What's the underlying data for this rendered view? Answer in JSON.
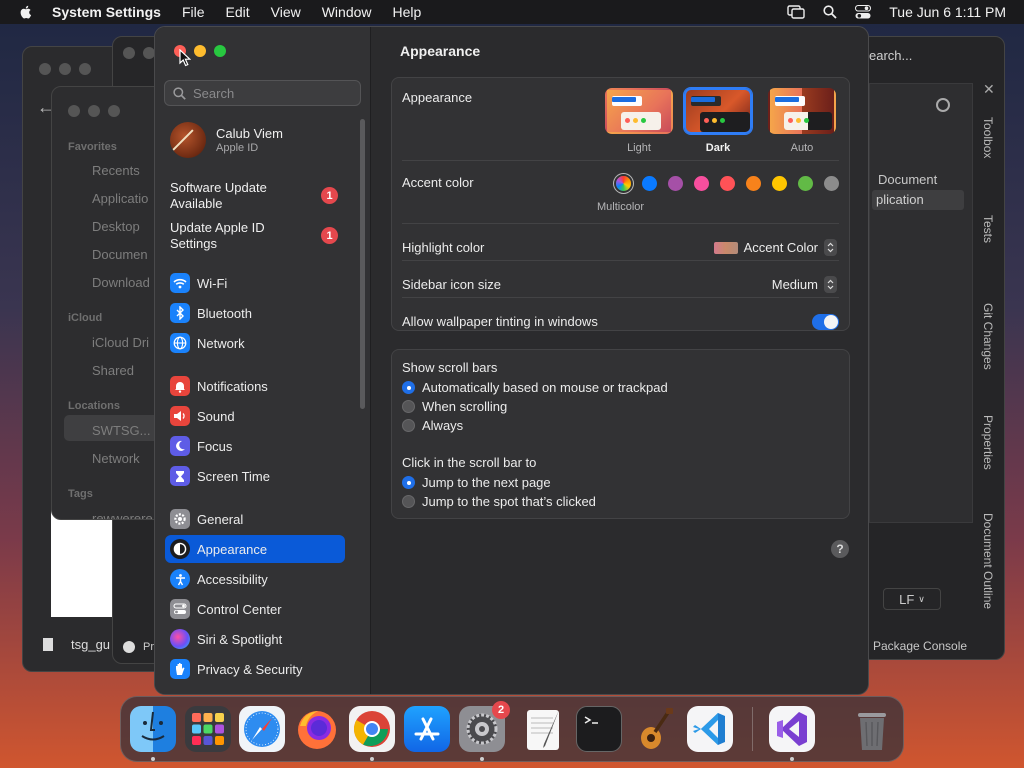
{
  "menubar": {
    "app_name": "System Settings",
    "menus": [
      "File",
      "Edit",
      "View",
      "Window",
      "Help"
    ],
    "clock": "Tue Jun 6  1:11 PM"
  },
  "finder": {
    "sections": [
      "Favorites",
      "iCloud",
      "Locations",
      "Tags"
    ],
    "favorites": [
      "Recents",
      "Applicatio",
      "Desktop",
      "Documen",
      "Download"
    ],
    "icloud": [
      "iCloud Dri",
      "Shared"
    ],
    "locations": [
      "SWTSG...",
      "Network"
    ],
    "tags": [
      "rewwerere"
    ],
    "file_name": "tsg_gu",
    "file_status": "Pr"
  },
  "ide": {
    "search_text": "earch...",
    "items": [
      "Document",
      "plication"
    ],
    "side_tabs": [
      "Toolbox",
      "Tests",
      "Git Changes",
      "Properties",
      "Document Outline"
    ],
    "line_ending": "LF",
    "console": "Package Console"
  },
  "settings": {
    "search_placeholder": "Search",
    "profile": {
      "name": "Calub Viem",
      "subtitle": "Apple ID"
    },
    "notices": [
      {
        "label": "Software Update Available",
        "badge": "1"
      },
      {
        "label": "Update Apple ID Settings",
        "badge": "1"
      }
    ],
    "sidebar": [
      {
        "label": "Wi-Fi",
        "icon": "wifi-icon",
        "color": "#1a82fb"
      },
      {
        "label": "Bluetooth",
        "icon": "bluetooth-icon",
        "color": "#1a82fb"
      },
      {
        "label": "Network",
        "icon": "globe-icon",
        "color": "#1a82fb"
      },
      {
        "label": "Notifications",
        "icon": "bell-icon",
        "color": "#e8453c"
      },
      {
        "label": "Sound",
        "icon": "speaker-icon",
        "color": "#e8453c"
      },
      {
        "label": "Focus",
        "icon": "moon-icon",
        "color": "#5e5ce6"
      },
      {
        "label": "Screen Time",
        "icon": "hourglass-icon",
        "color": "#5e5ce6"
      },
      {
        "label": "General",
        "icon": "gear-icon",
        "color": "#8e8e93"
      },
      {
        "label": "Appearance",
        "icon": "appearance-icon",
        "color": "#1c1c1e"
      },
      {
        "label": "Accessibility",
        "icon": "accessibility-icon",
        "color": "#1a82fb"
      },
      {
        "label": "Control Center",
        "icon": "control-center-icon",
        "color": "#8e8e93"
      },
      {
        "label": "Siri & Spotlight",
        "icon": "siri-icon",
        "color": "#9d4edd"
      },
      {
        "label": "Privacy & Security",
        "icon": "hand-icon",
        "color": "#1a82fb"
      }
    ],
    "active_item": "Appearance",
    "title": "Appearance",
    "appearance": {
      "label": "Appearance",
      "options": [
        "Light",
        "Dark",
        "Auto"
      ],
      "selected": "Dark"
    },
    "accent": {
      "label": "Accent color",
      "caption": "Multicolor",
      "colors": [
        "multicolor",
        "#0a7aff",
        "#a550a7",
        "#f74f9e",
        "#ff5257",
        "#f7821b",
        "#ffc600",
        "#62ba46",
        "#8c8c8c"
      ]
    },
    "highlight": {
      "label": "Highlight color",
      "value": "Accent Color"
    },
    "sidebar_icon": {
      "label": "Sidebar icon size",
      "value": "Medium"
    },
    "tinting": {
      "label": "Allow wallpaper tinting in windows",
      "enabled": true
    },
    "scroll_bars": {
      "label": "Show scroll bars",
      "options": [
        "Automatically based on mouse or trackpad",
        "When scrolling",
        "Always"
      ],
      "selected": 0
    },
    "click_scroll": {
      "label": "Click in the scroll bar to",
      "options": [
        "Jump to the next page",
        "Jump to the spot that’s clicked"
      ],
      "selected": 0
    },
    "help": "?"
  },
  "dock": {
    "apps": [
      "finder-icon",
      "launchpad-icon",
      "safari-icon",
      "firefox-icon",
      "chrome-icon",
      "app-store-icon",
      "system-settings-icon",
      "textedit-icon",
      "terminal-icon",
      "garageband-icon",
      "vscode-icon",
      "visual-studio-icon",
      "trash-icon"
    ],
    "settings_badge": "2"
  }
}
